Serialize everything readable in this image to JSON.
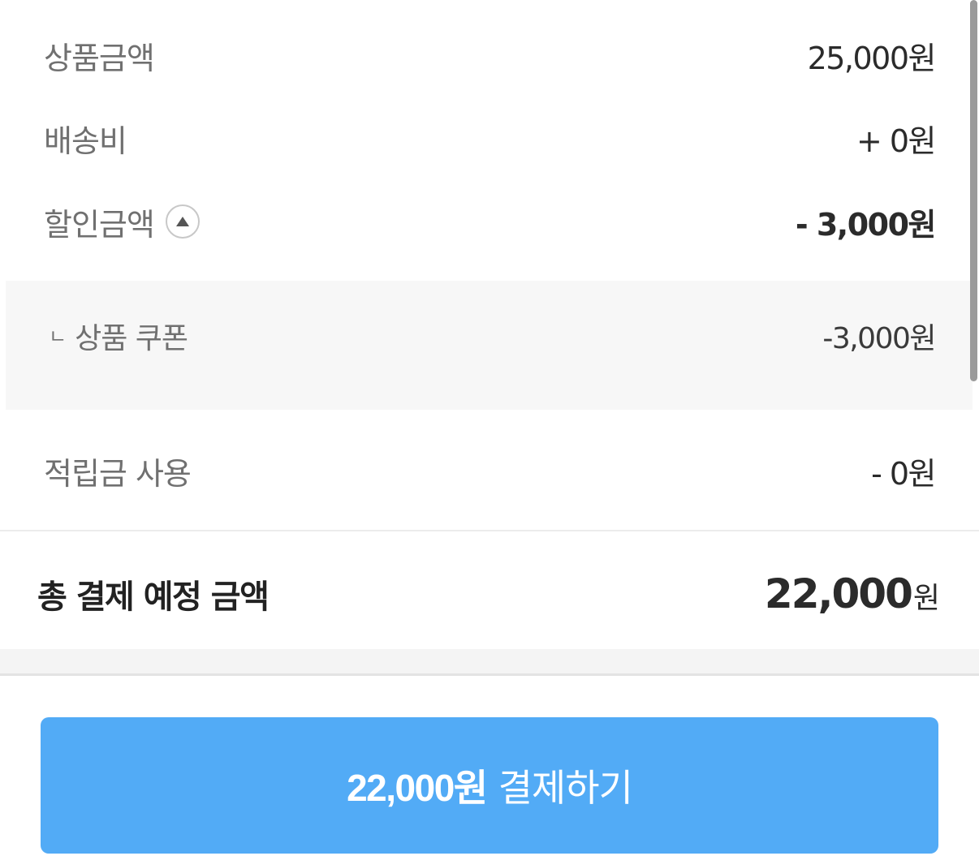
{
  "summary": {
    "product_amount": {
      "label": "상품금액",
      "value": "25,000원"
    },
    "shipping": {
      "label": "배송비",
      "value": "+ 0원"
    },
    "discount": {
      "label": "할인금액",
      "value": "- 3,000원",
      "toggle_icon": "chevron-up-circle-icon",
      "expanded": true
    },
    "discount_detail": {
      "marker": "ㄴ",
      "label": "상품 쿠폰",
      "value": "-3,000원"
    },
    "points": {
      "label": "적립금 사용",
      "value": "- 0원"
    }
  },
  "total": {
    "label": "총 결제 예정 금액",
    "amount": "22,000",
    "unit": "원"
  },
  "pay_button": {
    "amount": "22,000원",
    "action": "결제하기",
    "color": "#52abf6"
  }
}
